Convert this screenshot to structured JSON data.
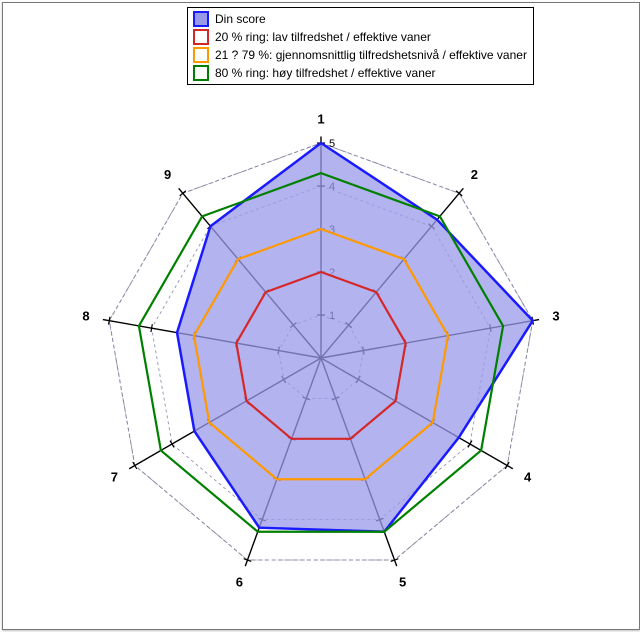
{
  "chart_data": {
    "type": "radar",
    "title": "",
    "axis_labels": [
      "1",
      "2",
      "3",
      "4",
      "5",
      "6",
      "7",
      "8",
      "9"
    ],
    "axis_range": [
      0,
      5
    ],
    "tick_values": [
      1,
      2,
      3,
      4,
      5
    ],
    "series": [
      {
        "name": "Din score",
        "color": "#1a1aff",
        "fill": "#9999ea",
        "values": [
          5.0,
          4.2,
          5.0,
          3.7,
          4.3,
          4.2,
          3.4,
          3.4,
          4.0
        ]
      },
      {
        "name": "20 % ring: lav tilfredshet / effektive vaner",
        "color": "#d62728",
        "fill": null,
        "values": [
          2,
          2,
          2,
          2,
          2,
          2,
          2,
          2,
          2
        ]
      },
      {
        "name": "21 ? 79 %: gjennomsnittlig tilfredshetsnivå / effektive vaner",
        "color": "#ff9900",
        "fill": null,
        "values": [
          3,
          3,
          3,
          3,
          3,
          3,
          3,
          3,
          3
        ]
      },
      {
        "name": "80 % ring: høy tilfredshet / effektive vaner",
        "color": "#008000",
        "fill": null,
        "values": [
          4.3,
          4.3,
          4.3,
          4.3,
          4.3,
          4.3,
          4.3,
          4.3,
          4.3
        ]
      }
    ]
  },
  "legend": {
    "rows": [
      {
        "label": "Din score",
        "swatch_fill": "#9999ea",
        "swatch_stroke": "#1a1aff"
      },
      {
        "label": "20 % ring: lav tilfredshet / effektive vaner",
        "swatch_fill": "#ffffff",
        "swatch_stroke": "#d62728"
      },
      {
        "label": "21 ? 79 %: gjennomsnittlig tilfredshetsnivå / effektive vaner",
        "swatch_fill": "#ffffff",
        "swatch_stroke": "#ff9900"
      },
      {
        "label": "80 % ring: høy tilfredshet / effektive vaner",
        "swatch_fill": "#ffffff",
        "swatch_stroke": "#008000"
      }
    ]
  }
}
